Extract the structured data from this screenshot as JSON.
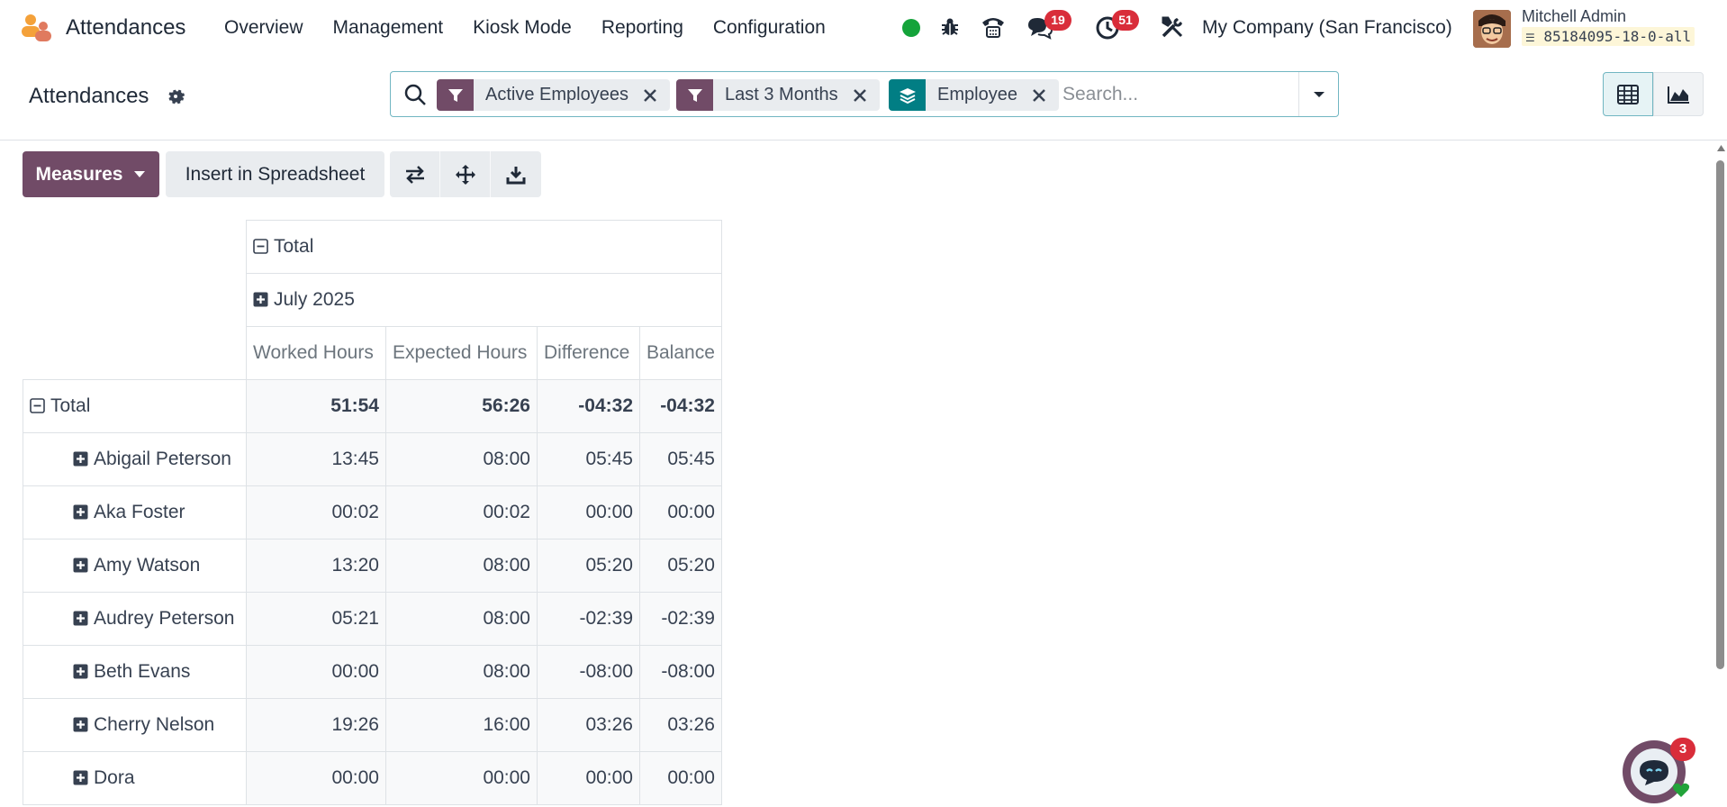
{
  "navbar": {
    "app_name": "Attendances",
    "menu": [
      "Overview",
      "Management",
      "Kiosk Mode",
      "Reporting",
      "Configuration"
    ],
    "messages_count": "19",
    "activities_count": "51",
    "company": "My Company (San Francisco)",
    "user_name": "Mitchell Admin",
    "database": "85184095-18-0-all",
    "status_color": "#14a33a"
  },
  "control_panel": {
    "title": "Attendances",
    "facets": [
      {
        "label": "Active Employees",
        "type": "filter",
        "color": "#714b67"
      },
      {
        "label": "Last 3 Months",
        "type": "filter",
        "color": "#714b67"
      },
      {
        "label": "Employee",
        "type": "groupby",
        "color": "#017e84"
      }
    ],
    "search_placeholder": "Search..."
  },
  "toolbar": {
    "measures_label": "Measures",
    "insert_label": "Insert in Spreadsheet"
  },
  "pivot": {
    "col_total": "Total",
    "col_group": "July 2025",
    "measures": [
      "Worked Hours",
      "Expected Hours",
      "Difference",
      "Balance"
    ],
    "total_label": "Total",
    "total_values": [
      "51:54",
      "56:26",
      "-04:32",
      "-04:32"
    ],
    "rows": [
      {
        "name": "Abigail Peterson",
        "values": [
          "13:45",
          "08:00",
          "05:45",
          "05:45"
        ]
      },
      {
        "name": "Aka Foster",
        "values": [
          "00:02",
          "00:02",
          "00:00",
          "00:00"
        ]
      },
      {
        "name": "Amy Watson",
        "values": [
          "13:20",
          "08:00",
          "05:20",
          "05:20"
        ]
      },
      {
        "name": "Audrey Peterson",
        "values": [
          "05:21",
          "08:00",
          "-02:39",
          "-02:39"
        ]
      },
      {
        "name": "Beth Evans",
        "values": [
          "00:00",
          "08:00",
          "-08:00",
          "-08:00"
        ]
      },
      {
        "name": "Cherry Nelson",
        "values": [
          "19:26",
          "16:00",
          "03:26",
          "03:26"
        ]
      },
      {
        "name": "Dora",
        "values": [
          "00:00",
          "00:00",
          "00:00",
          "00:00"
        ]
      }
    ]
  },
  "chat": {
    "badge": "3"
  }
}
